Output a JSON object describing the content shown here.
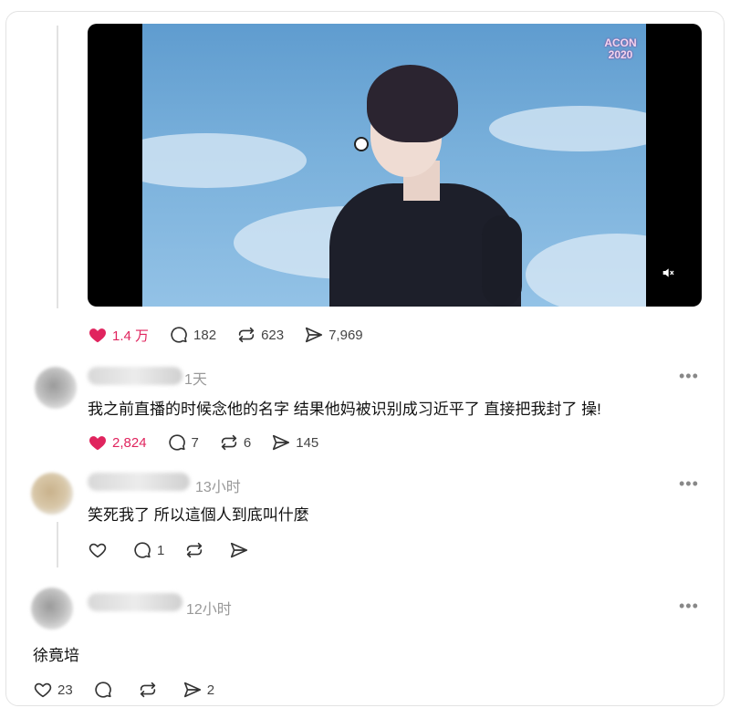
{
  "video": {
    "channel_logo_line1": "ACON",
    "channel_logo_line2": "2020",
    "mute_icon": "volume-mute-icon"
  },
  "post": {
    "likes": "1.4 万",
    "replies": "182",
    "reposts": "623",
    "shares": "7,969",
    "liked_color": "#e0245e"
  },
  "comments": [
    {
      "timestamp": "1天",
      "text": "我之前直播的时候念他的名字 结果他妈被识别成习近平了 直接把我封了 操!",
      "likes": "2,824",
      "replies": "7",
      "reposts": "6",
      "shares": "145",
      "liked": true
    },
    {
      "timestamp": "13小时",
      "text": "笑死我了 所以這個人到底叫什麼",
      "likes": "",
      "replies": "1",
      "reposts": "",
      "shares": "",
      "liked": false
    },
    {
      "timestamp": "12小时",
      "text": "徐竟培",
      "likes": "23",
      "replies": "",
      "reposts": "",
      "shares": "2",
      "liked": false
    }
  ],
  "more_label": "•••"
}
